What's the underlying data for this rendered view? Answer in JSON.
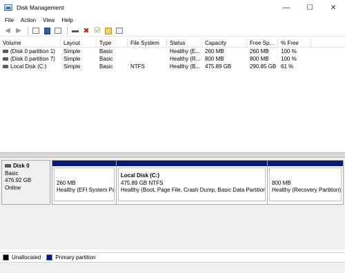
{
  "window": {
    "title": "Disk Management",
    "minimize": "—",
    "maximize": "☐",
    "close": "✕"
  },
  "menu": [
    "File",
    "Action",
    "View",
    "Help"
  ],
  "toolbar": {
    "icons": [
      "back-arrow-icon",
      "forward-arrow-icon",
      "disk-list-icon",
      "help-book-icon",
      "properties-icon",
      "connect-icon",
      "delete-icon",
      "check-icon",
      "new-volume-icon",
      "settings-icon"
    ]
  },
  "volume_list": {
    "columns": [
      "Volume",
      "Layout",
      "Type",
      "File System",
      "Status",
      "Capacity",
      "Free Sp...",
      "% Free"
    ],
    "rows": [
      {
        "volume": "(Disk 0 partition 1)",
        "layout": "Simple",
        "type": "Basic",
        "fs": "",
        "status": "Healthy (E...",
        "capacity": "260 MB",
        "free": "260 MB",
        "pct": "100 %"
      },
      {
        "volume": "(Disk 0 partition 7)",
        "layout": "Simple",
        "type": "Basic",
        "fs": "",
        "status": "Healthy (R...",
        "capacity": "800 MB",
        "free": "800 MB",
        "pct": "100 %"
      },
      {
        "volume": "Local Disk (C:)",
        "layout": "Simple",
        "type": "Basic",
        "fs": "NTFS",
        "status": "Healthy (B...",
        "capacity": "475.89 GB",
        "free": "290.85 GB",
        "pct": "61 %"
      }
    ]
  },
  "disk": {
    "name": "Disk 0",
    "type": "Basic",
    "size": "476.92 GB",
    "state": "Online",
    "partitions": [
      {
        "name": "",
        "size": "260 MB",
        "status": "Healthy (EFI System Par"
      },
      {
        "name": "Local Disk  (C:)",
        "size": "475.89 GB NTFS",
        "status": "Healthy (Boot, Page File, Crash Dump, Basic Data Partition)"
      },
      {
        "name": "",
        "size": "800 MB",
        "status": "Healthy (Recovery Partition)"
      }
    ]
  },
  "legend": [
    {
      "label": "Unallocated",
      "color": "#000000"
    },
    {
      "label": "Primary partition",
      "color": "#0a1a78"
    }
  ],
  "colors": {
    "partition_bar": "#0a1a78"
  }
}
